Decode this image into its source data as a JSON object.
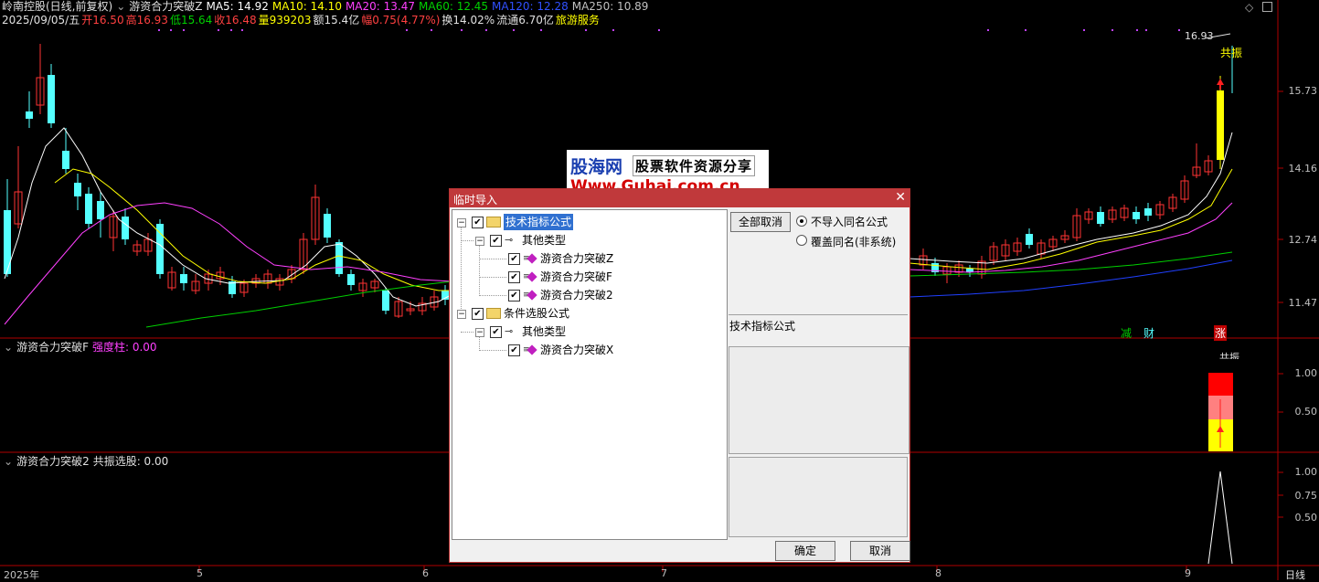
{
  "header": {
    "stock_name": "岭南控股(日线,前复权)",
    "formula_name": "游资合力突破Z",
    "ma5": "MA5: 14.92",
    "ma10": "MA10: 14.10",
    "ma20": "MA20: 13.47",
    "ma60": "MA60: 12.45",
    "ma120": "MA120: 12.28",
    "ma250": "MA250: 10.89",
    "date": "2025/09/05/五",
    "open": "开16.50",
    "high": "高16.93",
    "low": "低15.64",
    "close": "收16.48",
    "volume": "量939203",
    "amount": "额15.4亿",
    "change": "幅0.75(4.77%)",
    "turnover": "换14.02%",
    "float_cap": "流通6.70亿",
    "sector": "旅游服务"
  },
  "main_chart": {
    "y_labels": [
      "15.73",
      "14.16",
      "12.74",
      "11.47"
    ],
    "peak_label": "16.93",
    "signal_text": "共振",
    "markers": {
      "jian": "减",
      "cai": "财",
      "zhang": "涨"
    }
  },
  "sub1": {
    "title": "游资合力突破F",
    "indicator": "强度柱: 0.00",
    "y_labels": [
      "1.00",
      "0.50"
    ],
    "top_label": "共振"
  },
  "sub2": {
    "title": "游资合力突破2",
    "indicator": "共振选股: 0.00",
    "y_labels": [
      "1.00",
      "0.75",
      "0.50"
    ]
  },
  "x_axis": {
    "labels": [
      "2025年",
      "5",
      "6",
      "7",
      "8",
      "9"
    ],
    "period": "日线"
  },
  "watermark": {
    "logo": "股海网",
    "slogan": "股票软件资源分享",
    "url": "Www.Guhai.com.cn"
  },
  "dialog": {
    "title": "临时导入",
    "tree": {
      "root1": "技术指标公式",
      "root1_child": "其他类型",
      "root1_items": [
        "游资合力突破Z",
        "游资合力突破F",
        "游资合力突破2"
      ],
      "root2": "条件选股公式",
      "root2_child": "其他类型",
      "root2_items": [
        "游资合力突破X"
      ]
    },
    "cancel_all_label": "全部取消",
    "radio_no_import": "不导入同名公式",
    "radio_overwrite": "覆盖同名(非系统)",
    "info_label": "技术指标公式",
    "ok_label": "确定",
    "cancel_label": "取消"
  },
  "colors": {
    "up": "#ff3333",
    "down": "#54ffff",
    "ma5": "#ffffff",
    "ma10": "#ffff00",
    "ma20": "#ff40ff",
    "ma60": "#00d000",
    "ma120": "#2040ff",
    "grid": "#b00000",
    "dialog_title": "#c0393b"
  }
}
